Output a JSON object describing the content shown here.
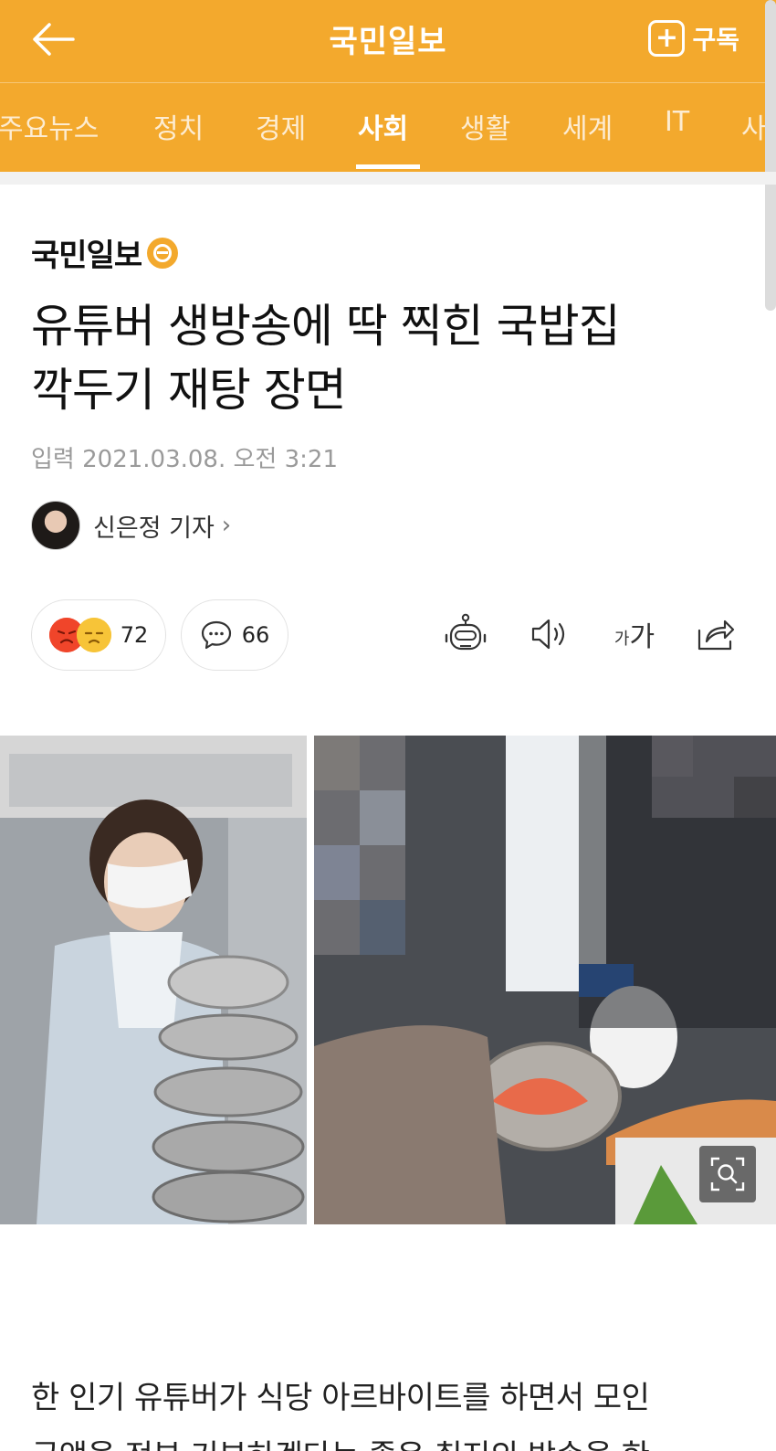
{
  "header": {
    "title": "국민일보",
    "subscribe_label": "구독",
    "subscribe_icon": "plus-box-icon",
    "back_icon": "arrow-left-icon",
    "bg_color": "#f3a92d"
  },
  "tabs": [
    {
      "label": "주요뉴스",
      "active": false
    },
    {
      "label": "정치",
      "active": false
    },
    {
      "label": "경제",
      "active": false
    },
    {
      "label": "사회",
      "active": true
    },
    {
      "label": "생활",
      "active": false
    },
    {
      "label": "세계",
      "active": false
    },
    {
      "label": "IT",
      "active": false
    },
    {
      "label": "사",
      "active": false
    }
  ],
  "article": {
    "publisher": "국민일보",
    "headline_line1": "유튜버 생방송에 딱 찍힌 국밥집",
    "headline_line2": "깍두기 재탕 장면",
    "date": "입력 2021.03.08. 오전 3:21",
    "reporter": "신은정 기자",
    "reactions_count": "72",
    "comments_count": "66",
    "font_size_label_small": "가",
    "font_size_label_large": "가",
    "body_line1": "한 인기 유튜버가 식당 아르바이트를 하면서 모인",
    "body_line2": "금액을 전부 기부하겠다는 좋은 취지의 방송을 한"
  },
  "icons": {
    "reaction_angry": "angry-face-icon",
    "reaction_sad": "sad-face-icon",
    "comment": "speech-bubble-icon",
    "robot": "robot-summary-icon",
    "speaker": "speaker-icon",
    "share": "share-icon",
    "zoom": "zoom-search-icon"
  }
}
